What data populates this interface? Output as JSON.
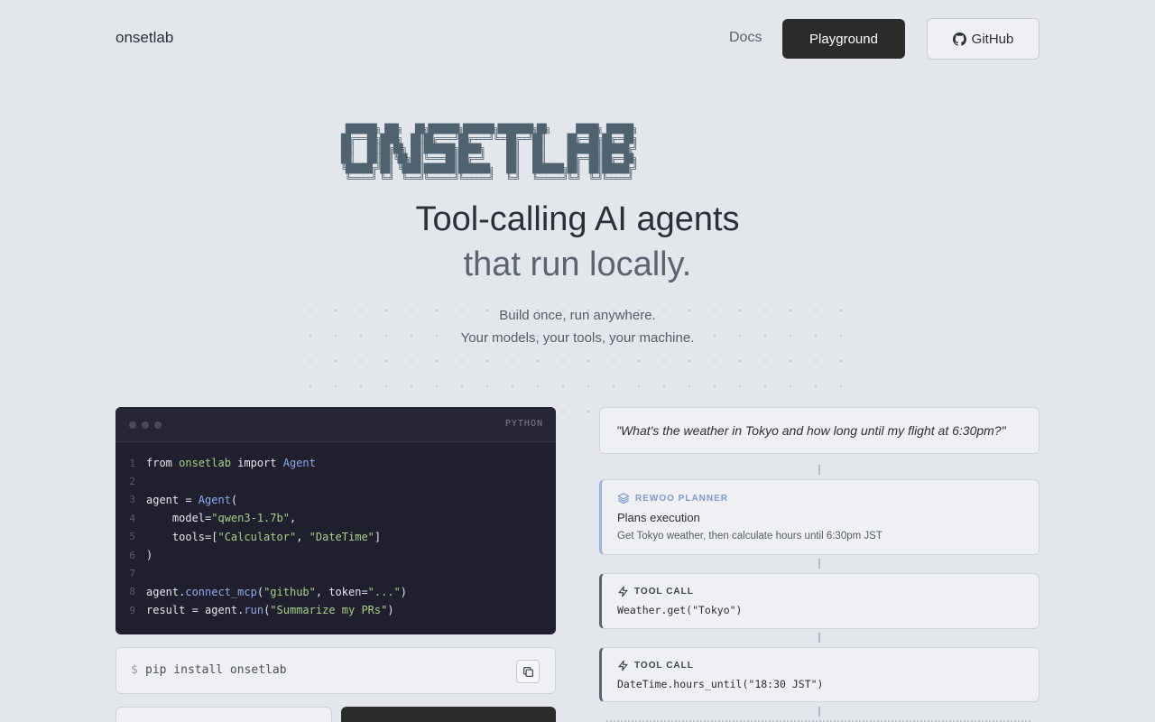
{
  "header": {
    "brand": "onsetlab",
    "nav_docs": "Docs",
    "playground_label": "Playground",
    "github_label": "GitHub"
  },
  "hero": {
    "ascii_logo": " ███████╗ ███╗   ██╗███████╗███████╗████████╗██╗      █████╗ ██████╗ \n██╔═══██╗████╗  ██║██╔════╝██╔════╝╚══██╔══╝██║     ██╔══██╗██╔══██╗\n██║   ██║██╔██╗ ██║███████╗█████╗     ██║   ██║     ███████║██████╔╝\n██║   ██║██║╚██╗██║╚════██║██╔══╝     ██║   ██║     ██╔══██║██╔══██╗\n╚██████╔╝██║ ╚████║███████║███████╗   ██║   ███████╗██║  ██║██████╔╝\n ╚═════╝ ╚═╝  ╚═══╝╚══════╝╚══════╝   ╚═╝   ╚══════╝╚═╝  ╚═╝╚═════╝ ",
    "title_line1": "Tool-calling AI agents",
    "title_line2": "that run locally.",
    "subtitle_line1": "Build once, run anywhere.",
    "subtitle_line2": "Your models, your tools, your machine."
  },
  "code": {
    "language": "PYTHON",
    "lines": [
      {
        "n": "1",
        "parts": [
          [
            "from ",
            "ct"
          ],
          [
            "onsetlab",
            "k-mod"
          ],
          [
            " import ",
            "ct"
          ],
          [
            "Agent",
            "k-cls"
          ]
        ]
      },
      {
        "n": "2",
        "parts": []
      },
      {
        "n": "3",
        "parts": [
          [
            "agent = ",
            "ct"
          ],
          [
            "Agent",
            "k-cls"
          ],
          [
            "(",
            "ct"
          ]
        ]
      },
      {
        "n": "4",
        "parts": [
          [
            "    model=",
            "ct"
          ],
          [
            "\"qwen3-1.7b\"",
            "k-str"
          ],
          [
            ",",
            "ct"
          ]
        ]
      },
      {
        "n": "5",
        "parts": [
          [
            "    tools=[",
            "ct"
          ],
          [
            "\"Calculator\"",
            "k-str"
          ],
          [
            ", ",
            "ct"
          ],
          [
            "\"DateTime\"",
            "k-str"
          ],
          [
            "]",
            "ct"
          ]
        ]
      },
      {
        "n": "6",
        "parts": [
          [
            ")",
            "ct"
          ]
        ]
      },
      {
        "n": "7",
        "parts": []
      },
      {
        "n": "8",
        "parts": [
          [
            "agent.",
            "ct"
          ],
          [
            "connect_mcp",
            "k-fn"
          ],
          [
            "(",
            "ct"
          ],
          [
            "\"github\"",
            "k-str"
          ],
          [
            ", token=",
            "ct"
          ],
          [
            "\"...\"",
            "k-str"
          ],
          [
            ")",
            "ct"
          ]
        ]
      },
      {
        "n": "9",
        "parts": [
          [
            "result = agent.",
            "ct"
          ],
          [
            "run",
            "k-fn"
          ],
          [
            "(",
            "ct"
          ],
          [
            "\"Summarize my PRs\"",
            "k-str"
          ],
          [
            ")",
            "ct"
          ]
        ]
      }
    ]
  },
  "install": {
    "prompt": "$",
    "command": "pip install onsetlab"
  },
  "flow": {
    "query": "\"What's the weather in Tokyo and how long until my flight at 6:30pm?\"",
    "planner": {
      "label": "REWOO PLANNER",
      "title": "Plans execution",
      "description": "Get Tokyo weather, then calculate hours until 6:30pm JST"
    },
    "tool_calls": [
      {
        "label": "TOOL CALL",
        "code": "Weather.get(\"Tokyo\")"
      },
      {
        "label": "TOOL CALL",
        "code": "DateTime.hours_until(\"18:30 JST\")"
      }
    ]
  },
  "colors": {
    "background": "#e3e7ec",
    "primary_button": "#2b2b2b",
    "code_background": "#1f1f2d",
    "planner_accent": "#7d9bd0"
  }
}
